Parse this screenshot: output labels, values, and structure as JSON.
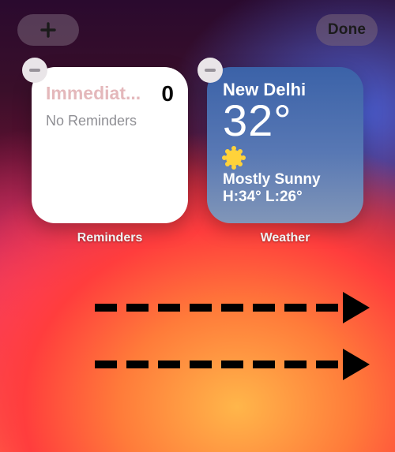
{
  "topbar": {
    "add_symbol": "+",
    "done_label": "Done"
  },
  "widgets": {
    "reminders": {
      "label": "Reminders",
      "list_title_truncated": "Immediat...",
      "count": "0",
      "empty_text": "No Reminders"
    },
    "weather": {
      "label": "Weather",
      "location": "New Delhi",
      "temperature": "32°",
      "condition": "Mostly Sunny",
      "hilo": "H:34° L:26°",
      "icon": "sun-icon"
    }
  },
  "annotation": {
    "direction": "right"
  }
}
